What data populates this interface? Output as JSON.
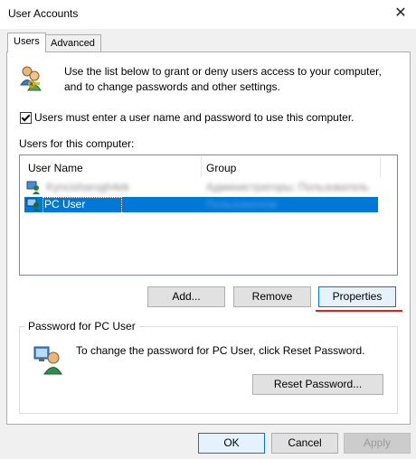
{
  "window": {
    "title": "User Accounts",
    "close_glyph": "✕"
  },
  "tabs": [
    {
      "label": "Users",
      "active": true
    },
    {
      "label": "Advanced",
      "active": false
    }
  ],
  "intro": {
    "line1": "Use the list below to grant or deny users access to your computer,",
    "line2": "and to change passwords and other settings."
  },
  "require_login": {
    "checked": true,
    "label": "Users must enter a user name and password to use this computer."
  },
  "users_section_label": "Users for this computer:",
  "table": {
    "columns": [
      "User Name",
      "Group"
    ],
    "rows": [
      {
        "name": "Kyncisharogh4ek",
        "group": "Администраторы; Пользователь",
        "selected": false
      },
      {
        "name": "PC User",
        "group": "Пользователи",
        "selected": true
      }
    ]
  },
  "buttons": {
    "add": "Add...",
    "remove": "Remove",
    "properties": "Properties"
  },
  "password_group": {
    "title": "Password for PC User",
    "text": "To change the password for PC User, click Reset Password.",
    "reset_button": "Reset Password..."
  },
  "dialog_buttons": {
    "ok": "OK",
    "cancel": "Cancel",
    "apply": "Apply"
  },
  "colors": {
    "selection": "#0078d7",
    "highlight_underline": "#e0201e"
  }
}
